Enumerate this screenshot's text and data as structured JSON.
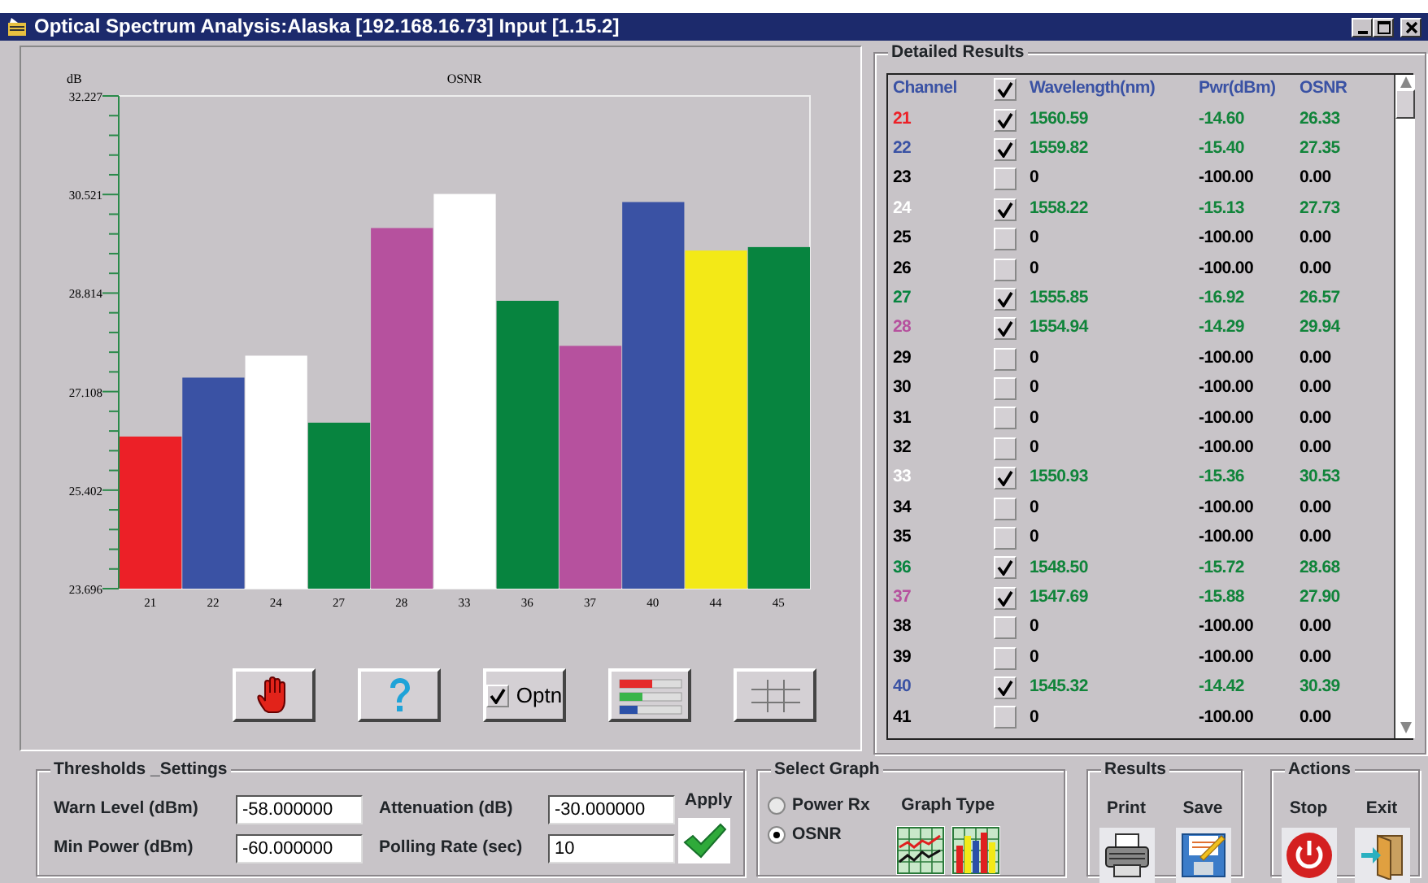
{
  "window": {
    "title": "Optical Spectrum Analysis:Alaska [192.168.16.73] Input [1.15.2]"
  },
  "chart": {
    "chart_data": {
      "type": "bar",
      "title": "OSNR",
      "ylabel": "dB",
      "categories": [
        "21",
        "22",
        "24",
        "27",
        "28",
        "33",
        "36",
        "37",
        "40",
        "44",
        "45"
      ],
      "series": [
        {
          "colors": [
            "#ec2027",
            "#3a52a4",
            "#ffffff",
            "#07843f",
            "#b6519e",
            "#ffffff",
            "#07843f",
            "#b6519e",
            "#3a52a4",
            "#f3e917",
            "#07843f"
          ],
          "values": [
            26.33,
            27.35,
            27.73,
            26.57,
            29.94,
            30.53,
            28.68,
            27.9,
            30.39,
            29.55,
            29.61
          ]
        }
      ],
      "ylim": [
        23.696,
        32.227
      ],
      "yticks": [
        23.696,
        25.402,
        27.108,
        28.814,
        30.521,
        32.227
      ]
    }
  },
  "toolbar": [
    {
      "kind": "hand"
    },
    {
      "kind": "help"
    },
    {
      "kind": "option",
      "label": "Optn",
      "checked": true
    },
    {
      "kind": "bars"
    },
    {
      "kind": "grid"
    }
  ],
  "results": {
    "title": "Detailed Results",
    "columns": [
      "Channel",
      "Wavelength(nm)",
      "Pwr(dBm)",
      "OSNR"
    ],
    "header_checked": true,
    "rows": [
      {
        "channel": "21",
        "color": "#ec2027",
        "checked": true,
        "wavelength": "1560.59",
        "pwr": "-14.60",
        "osnr": "26.33"
      },
      {
        "channel": "22",
        "color": "#3a52a4",
        "checked": true,
        "wavelength": "1559.82",
        "pwr": "-15.40",
        "osnr": "27.35"
      },
      {
        "channel": "23",
        "color": "#000000",
        "checked": false,
        "wavelength": "0",
        "pwr": "-100.00",
        "osnr": "0.00"
      },
      {
        "channel": "24",
        "color": "#ffffff",
        "checked": true,
        "wavelength": "1558.22",
        "pwr": "-15.13",
        "osnr": "27.73"
      },
      {
        "channel": "25",
        "color": "#000000",
        "checked": false,
        "wavelength": "0",
        "pwr": "-100.00",
        "osnr": "0.00"
      },
      {
        "channel": "26",
        "color": "#000000",
        "checked": false,
        "wavelength": "0",
        "pwr": "-100.00",
        "osnr": "0.00"
      },
      {
        "channel": "27",
        "color": "#07843f",
        "checked": true,
        "wavelength": "1555.85",
        "pwr": "-16.92",
        "osnr": "26.57"
      },
      {
        "channel": "28",
        "color": "#b6519e",
        "checked": true,
        "wavelength": "1554.94",
        "pwr": "-14.29",
        "osnr": "29.94"
      },
      {
        "channel": "29",
        "color": "#000000",
        "checked": false,
        "wavelength": "0",
        "pwr": "-100.00",
        "osnr": "0.00"
      },
      {
        "channel": "30",
        "color": "#000000",
        "checked": false,
        "wavelength": "0",
        "pwr": "-100.00",
        "osnr": "0.00"
      },
      {
        "channel": "31",
        "color": "#000000",
        "checked": false,
        "wavelength": "0",
        "pwr": "-100.00",
        "osnr": "0.00"
      },
      {
        "channel": "32",
        "color": "#000000",
        "checked": false,
        "wavelength": "0",
        "pwr": "-100.00",
        "osnr": "0.00"
      },
      {
        "channel": "33",
        "color": "#ffffff",
        "checked": true,
        "wavelength": "1550.93",
        "pwr": "-15.36",
        "osnr": "30.53"
      },
      {
        "channel": "34",
        "color": "#000000",
        "checked": false,
        "wavelength": "0",
        "pwr": "-100.00",
        "osnr": "0.00"
      },
      {
        "channel": "35",
        "color": "#000000",
        "checked": false,
        "wavelength": "0",
        "pwr": "-100.00",
        "osnr": "0.00"
      },
      {
        "channel": "36",
        "color": "#07843f",
        "checked": true,
        "wavelength": "1548.50",
        "pwr": "-15.72",
        "osnr": "28.68"
      },
      {
        "channel": "37",
        "color": "#b6519e",
        "checked": true,
        "wavelength": "1547.69",
        "pwr": "-15.88",
        "osnr": "27.90"
      },
      {
        "channel": "38",
        "color": "#000000",
        "checked": false,
        "wavelength": "0",
        "pwr": "-100.00",
        "osnr": "0.00"
      },
      {
        "channel": "39",
        "color": "#000000",
        "checked": false,
        "wavelength": "0",
        "pwr": "-100.00",
        "osnr": "0.00"
      },
      {
        "channel": "40",
        "color": "#3a52a4",
        "checked": true,
        "wavelength": "1545.32",
        "pwr": "-14.42",
        "osnr": "30.39"
      },
      {
        "channel": "41",
        "color": "#000000",
        "checked": false,
        "wavelength": "0",
        "pwr": "-100.00",
        "osnr": "0.00"
      }
    ]
  },
  "thresholds": {
    "title": "Thresholds _Settings",
    "fields": [
      {
        "label": "Warn Level (dBm)",
        "value": "-58.000000"
      },
      {
        "label": "Attenuation (dB)",
        "value": "-30.000000"
      },
      {
        "label": "Min Power (dBm)",
        "value": "-60.000000"
      },
      {
        "label": "Polling Rate (sec)",
        "value": "10"
      }
    ],
    "apply": "Apply"
  },
  "select_graph": {
    "title": "Select Graph",
    "options": [
      {
        "label": "Power Rx",
        "selected": false
      },
      {
        "label": "OSNR",
        "selected": true
      }
    ],
    "graph_type_label": "Graph Type",
    "graph_types": [
      {
        "kind": "line"
      },
      {
        "kind": "bar"
      }
    ]
  },
  "results_group": {
    "title": "Results",
    "buttons": [
      {
        "label": "Print",
        "kind": "print"
      },
      {
        "label": "Save",
        "kind": "save"
      }
    ]
  },
  "actions": {
    "title": "Actions",
    "buttons": [
      {
        "label": "Stop",
        "kind": "stop"
      },
      {
        "label": "Exit",
        "kind": "exit"
      }
    ]
  }
}
